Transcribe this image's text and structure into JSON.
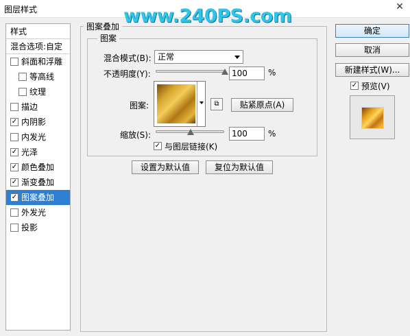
{
  "window": {
    "title": "图层样式",
    "watermark": "www.240PS.com"
  },
  "styles_list": {
    "header": "样式",
    "blend_options": "混合选项:自定",
    "items": [
      {
        "label": "斜面和浮雕",
        "checked": false,
        "sub": false,
        "selected": false
      },
      {
        "label": "等高线",
        "checked": false,
        "sub": true,
        "selected": false
      },
      {
        "label": "纹理",
        "checked": false,
        "sub": true,
        "selected": false
      },
      {
        "label": "描边",
        "checked": false,
        "sub": false,
        "selected": false
      },
      {
        "label": "内阴影",
        "checked": true,
        "sub": false,
        "selected": false
      },
      {
        "label": "内发光",
        "checked": false,
        "sub": false,
        "selected": false
      },
      {
        "label": "光泽",
        "checked": true,
        "sub": false,
        "selected": false
      },
      {
        "label": "颜色叠加",
        "checked": true,
        "sub": false,
        "selected": false
      },
      {
        "label": "渐变叠加",
        "checked": true,
        "sub": false,
        "selected": false
      },
      {
        "label": "图案叠加",
        "checked": true,
        "sub": false,
        "selected": true
      },
      {
        "label": "外发光",
        "checked": false,
        "sub": false,
        "selected": false
      },
      {
        "label": "投影",
        "checked": false,
        "sub": false,
        "selected": false
      }
    ]
  },
  "pattern_overlay": {
    "group_title": "图案叠加",
    "subgroup_title": "图案",
    "blend_mode_label": "混合模式(B):",
    "blend_mode_value": "正常",
    "opacity_label": "不透明度(Y):",
    "opacity_value": "100",
    "opacity_unit": "%",
    "opacity_level": 1.0,
    "pattern_label": "图案:",
    "snap_button": "贴紧原点(A)",
    "scale_label": "缩放(S):",
    "scale_value": "100",
    "scale_unit": "%",
    "scale_level": 0.5,
    "link_label": "与图层链接(K)",
    "link_checked": true,
    "set_default_button": "设置为默认值",
    "reset_default_button": "复位为默认值"
  },
  "right_panel": {
    "ok_button": "确定",
    "cancel_button": "取消",
    "new_style_button": "新建样式(W)...",
    "preview_label": "预览(V)",
    "preview_checked": true
  },
  "colors": {
    "selection": "#2f7fd2",
    "watermark": "#2fc4e8",
    "gold": "#d7a42e"
  }
}
